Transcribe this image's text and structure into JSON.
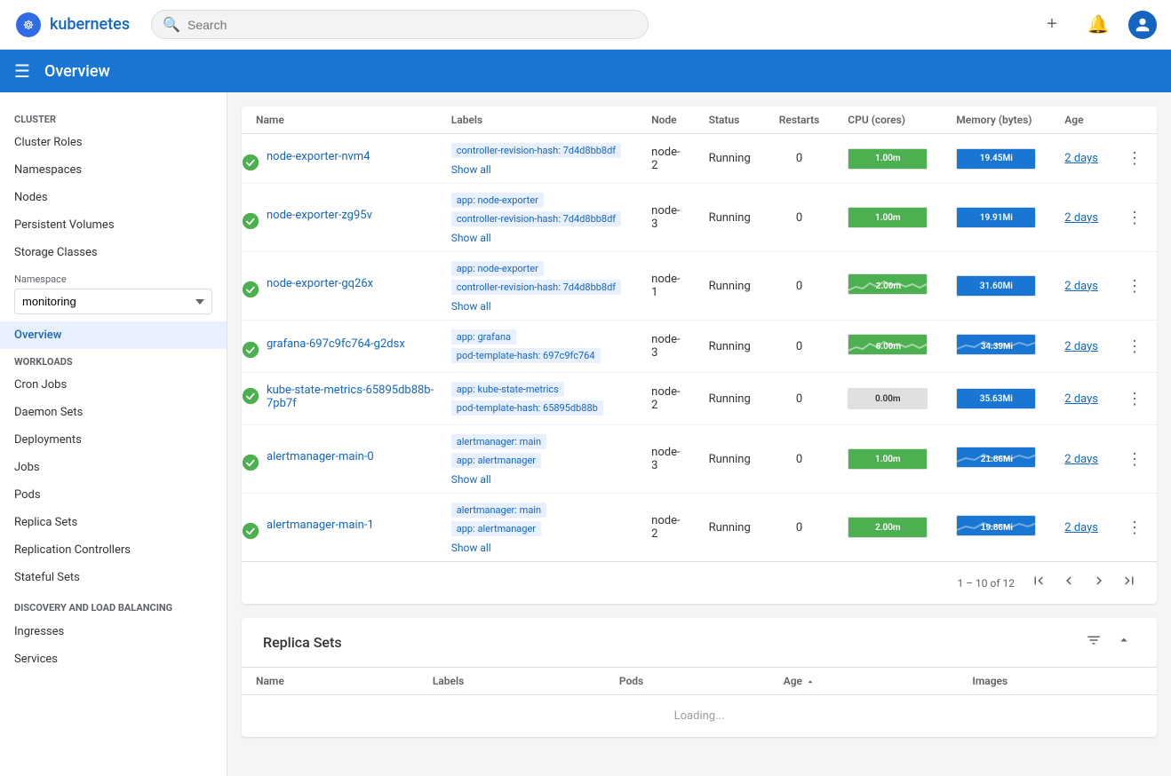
{
  "topnav": {
    "logo_text": "kubernetes",
    "search_placeholder": "Search",
    "plus_icon": "+",
    "bell_icon": "🔔",
    "avatar_icon": "👤"
  },
  "page_header": {
    "menu_icon": "☰",
    "title": "Overview"
  },
  "sidebar": {
    "cluster_section": "Cluster",
    "cluster_items": [
      {
        "label": "Cluster Roles",
        "id": "cluster-roles"
      },
      {
        "label": "Namespaces",
        "id": "namespaces"
      },
      {
        "label": "Nodes",
        "id": "nodes"
      },
      {
        "label": "Persistent Volumes",
        "id": "persistent-volumes"
      },
      {
        "label": "Storage Classes",
        "id": "storage-classes"
      }
    ],
    "namespace_label": "Namespace",
    "namespace_value": "monitoring",
    "workloads_section": "Workloads",
    "workload_items": [
      {
        "label": "Cron Jobs",
        "id": "cron-jobs"
      },
      {
        "label": "Daemon Sets",
        "id": "daemon-sets"
      },
      {
        "label": "Deployments",
        "id": "deployments"
      },
      {
        "label": "Jobs",
        "id": "jobs"
      },
      {
        "label": "Pods",
        "id": "pods"
      },
      {
        "label": "Replica Sets",
        "id": "replica-sets"
      },
      {
        "label": "Replication Controllers",
        "id": "replication-controllers"
      },
      {
        "label": "Stateful Sets",
        "id": "stateful-sets"
      }
    ],
    "discovery_section": "Discovery and Load Balancing",
    "discovery_items": [
      {
        "label": "Ingresses",
        "id": "ingresses"
      },
      {
        "label": "Services",
        "id": "services"
      }
    ],
    "overview_label": "Overview",
    "overview_id": "overview"
  },
  "pods_table": {
    "columns": [
      "Name",
      "Labels",
      "Node",
      "Status",
      "Restarts",
      "CPU (cores)",
      "Memory (bytes)",
      "Age"
    ],
    "pagination": {
      "info": "1 – 10 of 12",
      "first": "⏮",
      "prev": "◀",
      "next": "▶",
      "last": "⏭"
    },
    "rows": [
      {
        "name": "node-exporter-nvm4",
        "labels": [
          {
            "key": "controller-revision-hash",
            "value": "7d4d8bb8df"
          }
        ],
        "show_all": "Show all",
        "node": "node-2",
        "status": "Running",
        "restarts": "0",
        "cpu_value": "1.00m",
        "cpu_color": "green",
        "memory_value": "19.45Mi",
        "memory_color": "blue",
        "age": "2 days",
        "has_wavy_cpu": false,
        "has_wavy_mem": false
      },
      {
        "name": "node-exporter-zg95v",
        "labels": [
          {
            "key": "app",
            "value": "node-exporter"
          },
          {
            "key": "controller-revision-hash",
            "value": "7d4d8bb8df"
          }
        ],
        "show_all": "Show all",
        "node": "node-3",
        "status": "Running",
        "restarts": "0",
        "cpu_value": "1.00m",
        "cpu_color": "green",
        "memory_value": "19.91Mi",
        "memory_color": "blue",
        "age": "2 days",
        "has_wavy_cpu": false,
        "has_wavy_mem": false
      },
      {
        "name": "node-exporter-gq26x",
        "labels": [
          {
            "key": "app",
            "value": "node-exporter"
          },
          {
            "key": "controller-revision-hash",
            "value": "7d4d8bb8df"
          }
        ],
        "show_all": "Show all",
        "node": "node-1",
        "status": "Running",
        "restarts": "0",
        "cpu_value": "2.00m",
        "cpu_color": "green",
        "memory_value": "31.60Mi",
        "memory_color": "blue",
        "age": "2 days",
        "has_wavy_cpu": true,
        "has_wavy_mem": false
      },
      {
        "name": "grafana-697c9fc764-g2dsx",
        "labels": [
          {
            "key": "app",
            "value": "grafana"
          },
          {
            "key": "pod-template-hash",
            "value": "697c9fc764"
          }
        ],
        "show_all": null,
        "node": "node-3",
        "status": "Running",
        "restarts": "0",
        "cpu_value": "6.00m",
        "cpu_color": "green",
        "memory_value": "34.39Mi",
        "memory_color": "blue",
        "age": "2 days",
        "has_wavy_cpu": true,
        "has_wavy_mem": true
      },
      {
        "name": "kube-state-metrics-65895db88b-7pb7f",
        "labels": [
          {
            "key": "app",
            "value": "kube-state-metrics"
          },
          {
            "key": "pod-template-hash",
            "value": "65895db88b"
          }
        ],
        "show_all": null,
        "node": "node-2",
        "status": "Running",
        "restarts": "0",
        "cpu_value": "0.00m",
        "cpu_color": "light",
        "memory_value": "35.63Mi",
        "memory_color": "blue",
        "age": "2 days",
        "has_wavy_cpu": false,
        "has_wavy_mem": false
      },
      {
        "name": "alertmanager-main-0",
        "labels": [
          {
            "key": "alertmanager",
            "value": "main"
          },
          {
            "key": "app",
            "value": "alertmanager"
          }
        ],
        "show_all": "Show all",
        "node": "node-3",
        "status": "Running",
        "restarts": "0",
        "cpu_value": "1.00m",
        "cpu_color": "green",
        "memory_value": "21.86Mi",
        "memory_color": "blue",
        "age": "2 days",
        "has_wavy_cpu": false,
        "has_wavy_mem": true
      },
      {
        "name": "alertmanager-main-1",
        "labels": [
          {
            "key": "alertmanager",
            "value": "main"
          },
          {
            "key": "app",
            "value": "alertmanager"
          }
        ],
        "show_all": "Show all",
        "node": "node-2",
        "status": "Running",
        "restarts": "0",
        "cpu_value": "2.00m",
        "cpu_color": "green",
        "memory_value": "19.86Mi",
        "memory_color": "blue",
        "age": "2 days",
        "has_wavy_cpu": false,
        "has_wavy_mem": true
      }
    ]
  },
  "replica_sets": {
    "title": "Replica Sets",
    "columns": [
      "Name",
      "Labels",
      "Pods",
      "Age",
      "Images"
    ]
  }
}
